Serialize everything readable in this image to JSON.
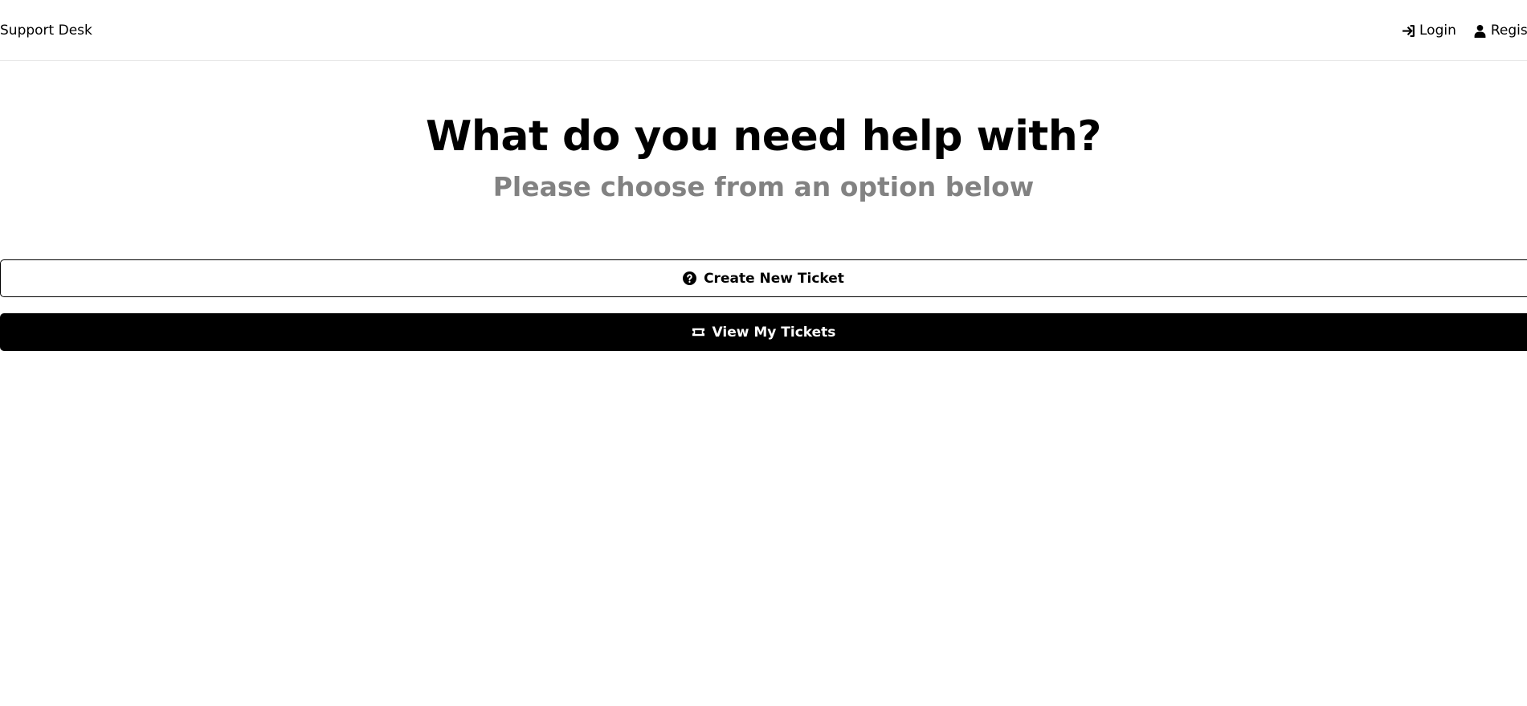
{
  "header": {
    "brand": "Support Desk",
    "nav": [
      {
        "label": "Login",
        "icon": "sign-in-icon"
      },
      {
        "label": "Register",
        "icon": "user-icon"
      }
    ]
  },
  "main": {
    "title": "What do you need help with?",
    "subtitle": "Please choose from an option below",
    "buttons": [
      {
        "label": "Create New Ticket",
        "icon": "question-circle-icon",
        "style": "outline"
      },
      {
        "label": "View My Tickets",
        "icon": "ticket-icon",
        "style": "solid"
      }
    ]
  },
  "colors": {
    "primary": "#000000",
    "background": "#ffffff",
    "subtitle": "#828282",
    "divider": "#e6e6e6"
  }
}
